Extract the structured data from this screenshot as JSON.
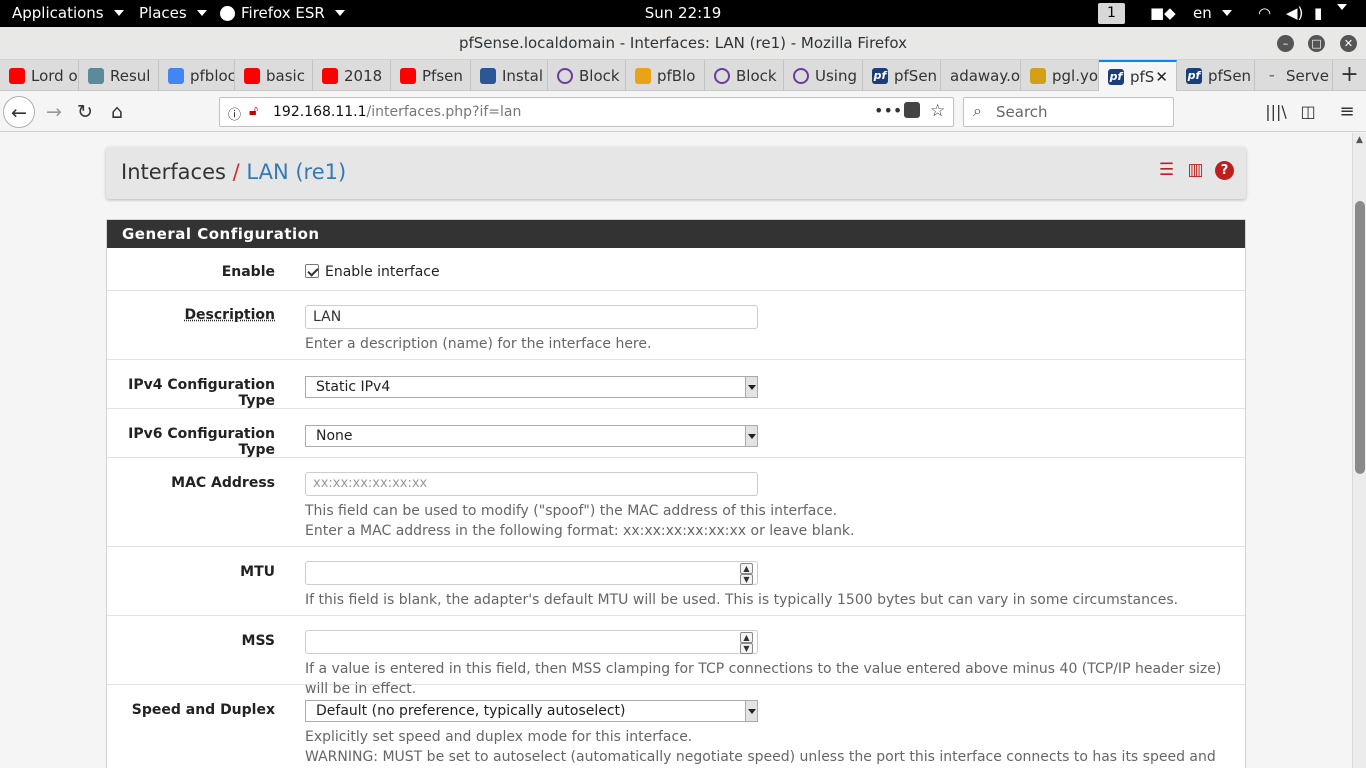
{
  "desktop": {
    "applications_label": "Applications",
    "places_label": "Places",
    "firefox_label": "Firefox ESR",
    "clock": "Sun 22:19",
    "workspace": "1",
    "language": "en"
  },
  "window": {
    "title": "pfSense.localdomain - Interfaces: LAN (re1) - Mozilla Firefox"
  },
  "tabs": [
    {
      "label": "Lord o",
      "icon": "youtube-icon",
      "color": "#ff0000"
    },
    {
      "label": "Resul",
      "icon": "site-icon",
      "color": "#5b8a9a"
    },
    {
      "label": "pfbloc",
      "icon": "google-icon",
      "color": "#4285f4"
    },
    {
      "label": "basic",
      "icon": "youtube-icon",
      "color": "#ff0000"
    },
    {
      "label": "2018",
      "icon": "youtube-icon",
      "color": "#ff0000"
    },
    {
      "label": "Pfsen",
      "icon": "youtube-icon",
      "color": "#ff0000"
    },
    {
      "label": "Instal",
      "icon": "site-icon",
      "color": "#2b5797"
    },
    {
      "label": "Block",
      "icon": "circle-icon",
      "color": "#6a3d9a"
    },
    {
      "label": "pfBlo",
      "icon": "site-icon",
      "color": "#e8a317"
    },
    {
      "label": "Block",
      "icon": "circle-icon",
      "color": "#6a3d9a"
    },
    {
      "label": "Using",
      "icon": "circle-icon",
      "color": "#6a3d9a"
    },
    {
      "label": "pfSen",
      "icon": "pfsense-icon",
      "color": "#1a3e7a"
    },
    {
      "label": "adaway.o",
      "icon": "",
      "color": ""
    },
    {
      "label": "pgl.yo",
      "icon": "site-icon",
      "color": "#d4a017"
    },
    {
      "label": "pfS",
      "icon": "pfsense-icon",
      "color": "#1a3e7a"
    },
    {
      "label": "pfSen",
      "icon": "pfsense-icon",
      "color": "#1a3e7a"
    },
    {
      "label": "Serve",
      "icon": "dash-icon",
      "color": "#666666"
    }
  ],
  "nav": {
    "url_host": "192.168.11.1",
    "url_path": "/interfaces.php?if=lan",
    "search_placeholder": "Search"
  },
  "page": {
    "breadcrumb_root": "Interfaces",
    "breadcrumb_sep": "/",
    "breadcrumb_current": "LAN (re1)",
    "panel_title": "General Configuration",
    "enable": {
      "label": "Enable",
      "checkbox_label": "Enable interface",
      "checked": true
    },
    "description": {
      "label": "Description",
      "value": "LAN",
      "help": "Enter a description (name) for the interface here."
    },
    "ipv4": {
      "label": "IPv4 Configuration Type",
      "value": "Static IPv4"
    },
    "ipv6": {
      "label": "IPv6 Configuration Type",
      "value": "None"
    },
    "mac": {
      "label": "MAC Address",
      "placeholder": "xx:xx:xx:xx:xx:xx",
      "help1": "This field can be used to modify (\"spoof\") the MAC address of this interface.",
      "help2": "Enter a MAC address in the following format: xx:xx:xx:xx:xx:xx or leave blank."
    },
    "mtu": {
      "label": "MTU",
      "help": "If this field is blank, the adapter's default MTU will be used. This is typically 1500 bytes but can vary in some circumstances."
    },
    "mss": {
      "label": "MSS",
      "help": "If a value is entered in this field, then MSS clamping for TCP connections to the value entered above minus 40 (TCP/IP header size) will be in effect."
    },
    "speed": {
      "label": "Speed and Duplex",
      "value": "Default (no preference, typically autoselect)",
      "help1": "Explicitly set speed and duplex mode for this interface.",
      "help2": "WARNING: MUST be set to autoselect (automatically negotiate speed) unless the port this interface connects to has its speed and duplex forced."
    }
  }
}
